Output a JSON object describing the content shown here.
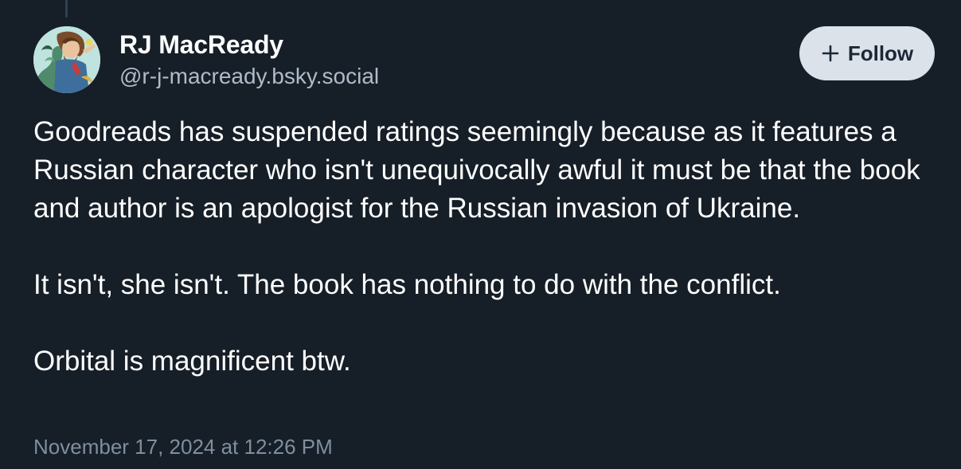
{
  "post": {
    "author": {
      "display_name": "RJ MacReady",
      "handle": "@r-j-macready.bsky.social",
      "avatar_icon": "illustrated-character-avatar"
    },
    "follow_button": {
      "label": "Follow",
      "icon": "plus-icon"
    },
    "paragraphs": [
      "Goodreads has suspended ratings seemingly because as it features a Russian character who isn't unequivocally awful it must be that the book and author is an apologist for the Russian invasion of Ukraine.",
      "It isn't, she isn't. The book has nothing to do with the conflict.",
      "Orbital is magnificent btw."
    ],
    "timestamp": "November 17, 2024 at 12:26 PM"
  },
  "colors": {
    "background": "#161e27",
    "text_primary": "#ffffff",
    "text_secondary": "#aebbc9",
    "text_muted": "#7f8fa0",
    "button_bg": "#dce2ea",
    "button_text": "#1b2735",
    "thread_line": "#2e4052"
  }
}
